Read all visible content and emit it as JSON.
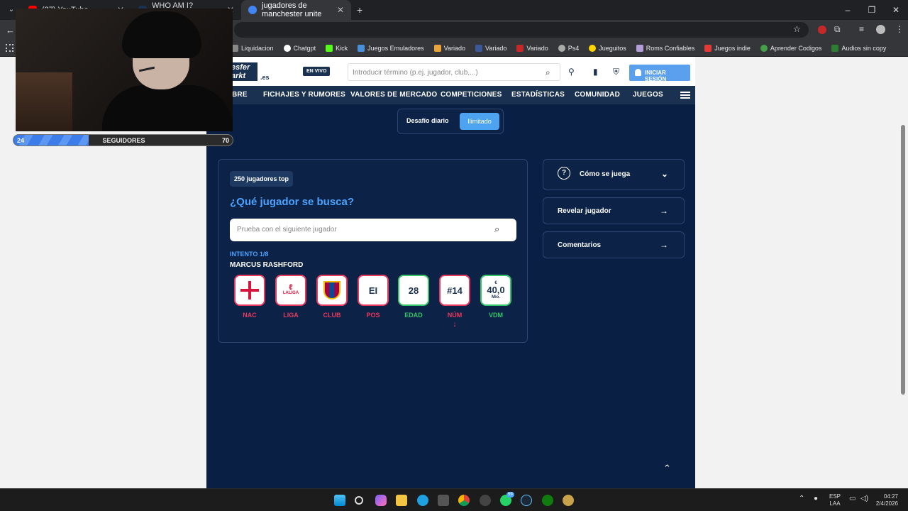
{
  "browser": {
    "tabs": [
      {
        "label": "(27) YouTube",
        "color": "#ff0000"
      },
      {
        "label": "WHO AM I? Transfermarkt",
        "color": "#1a3151"
      },
      {
        "label": "jugadores de manchester unite",
        "color": "#4285f4"
      }
    ],
    "bookmarks": [
      {
        "label": "Liquidacion",
        "color": "#888888"
      },
      {
        "label": "Chatgpt",
        "color": "#ffffff"
      },
      {
        "label": "Kick",
        "color": "#53fc18"
      },
      {
        "label": "Juegos Emuladores",
        "color": "#4a90d9"
      },
      {
        "label": "Variado",
        "color": "#e8a33b"
      },
      {
        "label": "Variado",
        "color": "#3b5998"
      },
      {
        "label": "Variado",
        "color": "#c62828"
      },
      {
        "label": "Ps4",
        "color": "#aaaaaa"
      },
      {
        "label": "Jueguitos",
        "color": "#ffd400"
      },
      {
        "label": "Roms Confiables",
        "color": "#b39ddb"
      },
      {
        "label": "Juegos indie",
        "color": "#e53935"
      },
      {
        "label": "Aprender Codigos",
        "color": "#43a047"
      },
      {
        "label": "Audios sin copy",
        "color": "#2e7d32"
      }
    ]
  },
  "site": {
    "logo": "esfer arkt",
    "domain": ".es",
    "live_badge": "EN VIVO",
    "search_placeholder": "Introducir término (p.ej. jugador, club,...)",
    "login": "INICIAR SESIÓN",
    "nav": [
      "BRE",
      "FICHAJES Y RUMORES",
      "VALORES DE MERCADO",
      "COMPETICIONES",
      "ESTADÍSTICAS",
      "COMUNIDAD",
      "JUEGOS"
    ]
  },
  "game": {
    "mode_daily": "Desafío diario",
    "mode_unlimited": "Ilimitado",
    "badge": "250 jugadores top",
    "question": "¿Qué jugador se busca?",
    "input_placeholder": "Prueba con el siguiente jugador",
    "attempt": "INTENTO 1/8",
    "player": "MARCUS RASHFORD",
    "clues": [
      {
        "label": "NAC",
        "value": "",
        "status": "red"
      },
      {
        "label": "LIGA",
        "value": "LALIGA",
        "status": "red"
      },
      {
        "label": "CLUB",
        "value": "",
        "status": "red"
      },
      {
        "label": "POS",
        "value": "EI",
        "status": "red"
      },
      {
        "label": "EDAD",
        "value": "28",
        "status": "green"
      },
      {
        "label": "NÚM",
        "value": "#14",
        "status": "red",
        "hint": "↓"
      },
      {
        "label": "VDM",
        "value": "40,0",
        "prefix": "€",
        "suffix": "Mio.",
        "status": "green"
      }
    ],
    "side": {
      "how": "Cómo se juega",
      "reveal": "Revelar jugador",
      "comments": "Comentarios"
    }
  },
  "overlay": {
    "followers_label": "SEGUIDORES",
    "current": "24",
    "goal": "70",
    "progress": 0.343
  },
  "tray": {
    "lang": "ESP",
    "layout": "LAA",
    "time": "04:27",
    "date": "2/4/2026",
    "whatsapp_badge": "59"
  }
}
